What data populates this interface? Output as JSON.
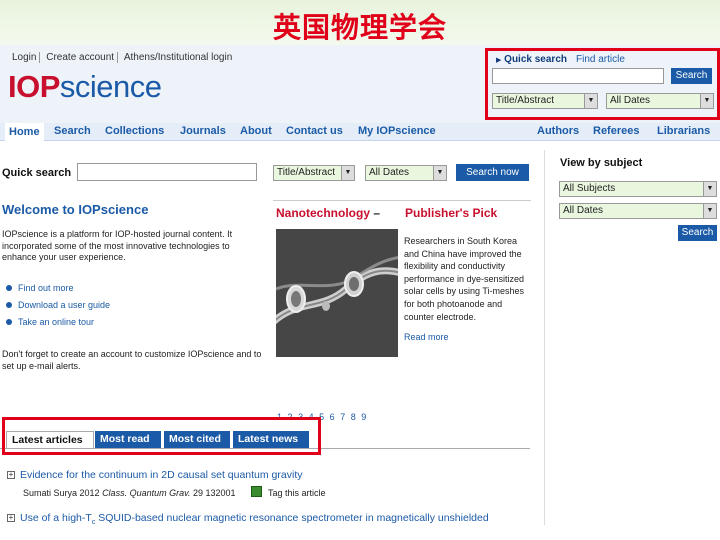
{
  "slide": {
    "title": "英国物理学会"
  },
  "header": {
    "top_links": [
      "Login",
      "Create account",
      "Athens/Institutional login"
    ],
    "logo_iop": "IOP",
    "logo_science": "science",
    "quick_search": {
      "label": "Quick search",
      "find_article": "Find article",
      "search_button": "Search",
      "field_select": "Title/Abstract",
      "date_select": "All Dates"
    }
  },
  "nav": {
    "left": [
      "Home",
      "Search",
      "Collections",
      "Journals",
      "About",
      "Contact us",
      "My IOPscience"
    ],
    "right": [
      "Authors",
      "Referees",
      "Librarians"
    ]
  },
  "main_search": {
    "label": "Quick search",
    "field_select": "Title/Abstract",
    "date_select": "All Dates",
    "button": "Search now"
  },
  "welcome": {
    "title": "Welcome to IOPscience",
    "intro": "IOPscience is a platform for IOP-hosted journal content. It incorporated some of the most innovative technologies to enhance your user experience.",
    "links": [
      "Find out more",
      "Download a user guide",
      "Take an online tour"
    ],
    "reminder": "Don't forget to create an account to customize IOPscience and to set up e-mail alerts."
  },
  "publishers_pick": {
    "journal": "Nanotechnology",
    "separator": "–",
    "heading": "Publisher's Pick",
    "text": "Researchers in South Korea and China have improved the flexibility and conductivity performance in dye-sensitized solar cells by using Ti-meshes for both photoanode and counter electrode.",
    "read_more": "Read more",
    "pages": [
      "1",
      "2",
      "3",
      "4",
      "5",
      "6",
      "7",
      "8",
      "9"
    ]
  },
  "subject": {
    "title": "View by subject",
    "subjects_select": "All Subjects",
    "dates_select": "All Dates",
    "button": "Search"
  },
  "article_tabs": [
    "Latest articles",
    "Most read",
    "Most cited",
    "Latest news"
  ],
  "articles": {
    "first_title": "Evidence for the continuum in 2D causal set quantum gravity",
    "first_authors": "Sumati Surya 2012",
    "first_journal": "Class. Quantum Grav.",
    "first_ref": "29 132001",
    "tag_text": "Tag this article",
    "second_title_prefix": "Use of a high-T",
    "second_title_sub": "c",
    "second_title_suffix": " SQUID-based nuclear magnetic resonance spectrometer in magnetically unshielded"
  },
  "colors": {
    "brand_red": "#c8102e",
    "brand_blue": "#1b5aa6",
    "highlight_frame": "#e0001a"
  }
}
